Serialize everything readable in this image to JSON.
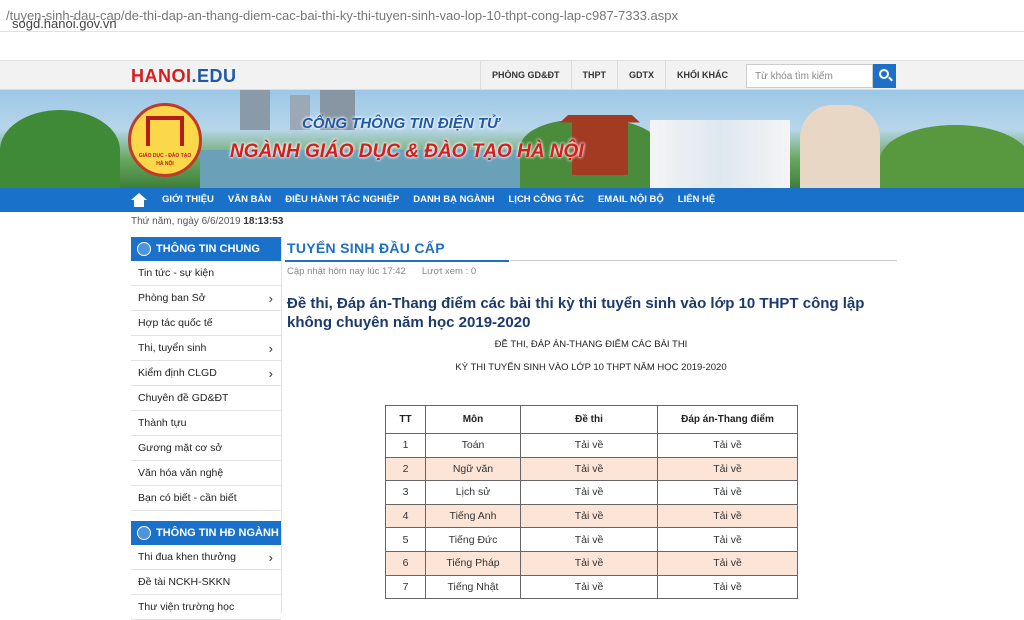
{
  "browser": {
    "url_domain": "sogd.hanoi.gov.vn",
    "url_path": "/tuyen-sinh-dau-cap/de-thi-dap-an-thang-diem-cac-bai-thi-ky-thi-tuyen-sinh-vao-lop-10-thpt-cong-lap-c987-7333.aspx"
  },
  "header": {
    "logo_main": "HANOI",
    "logo_suffix": ".EDU",
    "top_nav": [
      "PHÒNG GD&ĐT",
      "THPT",
      "GDTX",
      "KHỐI KHÁC"
    ],
    "search_placeholder": "Từ khóa tìm kiếm"
  },
  "banner": {
    "seal_line1": "GIÁO DỤC - ĐÀO TẠO",
    "seal_line2": "HÀ NỘI",
    "title_line1": "CỔNG THÔNG TIN ĐIỆN TỬ",
    "title_line2": "NGÀNH GIÁO DỤC & ĐÀO TẠO HÀ NỘI"
  },
  "main_nav": [
    "GIỚI THIỆU",
    "VĂN BẢN",
    "ĐIỀU HÀNH TÁC NGHIỆP",
    "DANH BẠ NGÀNH",
    "LỊCH CÔNG TÁC",
    "EMAIL NỘI BỘ",
    "LIÊN HỆ"
  ],
  "date": {
    "day": "Thứ năm, ngày 6/6/2019",
    "time": "18:13:53"
  },
  "sidebar": {
    "section1_title": "THÔNG TIN CHUNG",
    "section1_items": [
      {
        "label": "Tin tức - sự kiện",
        "chevron": ""
      },
      {
        "label": "Phòng ban Sở",
        "chevron": "›"
      },
      {
        "label": "Hợp tác quốc tế",
        "chevron": ""
      },
      {
        "label": "Thi, tuyển sinh",
        "chevron": "›"
      },
      {
        "label": "Kiểm định CLGD",
        "chevron": "›"
      },
      {
        "label": "Chuyên đề GD&ĐT",
        "chevron": ""
      },
      {
        "label": "Thành tựu",
        "chevron": ""
      },
      {
        "label": "Gương mặt cơ sở",
        "chevron": ""
      },
      {
        "label": "Văn hóa văn nghệ",
        "chevron": ""
      },
      {
        "label": "Bạn có biết - cần biết",
        "chevron": ""
      }
    ],
    "section2_title": "THÔNG TIN HĐ NGÀNH",
    "section2_items": [
      {
        "label": "Thi đua khen thưởng",
        "chevron": "›"
      },
      {
        "label": "Đề tài NCKH-SKKN",
        "chevron": ""
      },
      {
        "label": "Thư viện trường học",
        "chevron": ""
      }
    ]
  },
  "article": {
    "section_title": "TUYỂN SINH ĐẦU CẤP",
    "updated": "Cập nhật hôm nay lúc 17:42",
    "views": "Lượt xem : 0",
    "title": "Đề thi, Đáp án-Thang điểm các bài thi kỳ thi tuyển sinh vào lớp 10 THPT công lập không chuyên năm học 2019-2020",
    "subtitle1": "ĐỀ THI, ĐÁP ÁN-THANG ĐIỂM CÁC BÀI THI",
    "subtitle2": "KỲ THI TUYỂN SINH VÀO LỚP 10 THPT NĂM HỌC 2019-2020",
    "table": {
      "headers": [
        "TT",
        "Môn",
        "Đề thi",
        "Đáp án-Thang điểm"
      ],
      "rows": [
        [
          "1",
          "Toán",
          "Tải về",
          "Tải về"
        ],
        [
          "2",
          "Ngữ văn",
          "Tải về",
          "Tải về"
        ],
        [
          "3",
          "Lịch sử",
          "Tải về",
          "Tải về"
        ],
        [
          "4",
          "Tiếng Anh",
          "Tải về",
          "Tải về"
        ],
        [
          "5",
          "Tiếng Đức",
          "Tải về",
          "Tải về"
        ],
        [
          "6",
          "Tiếng Pháp",
          "Tải về",
          "Tải về"
        ],
        [
          "7",
          "Tiếng Nhật",
          "Tải về",
          "Tải về"
        ]
      ]
    }
  }
}
